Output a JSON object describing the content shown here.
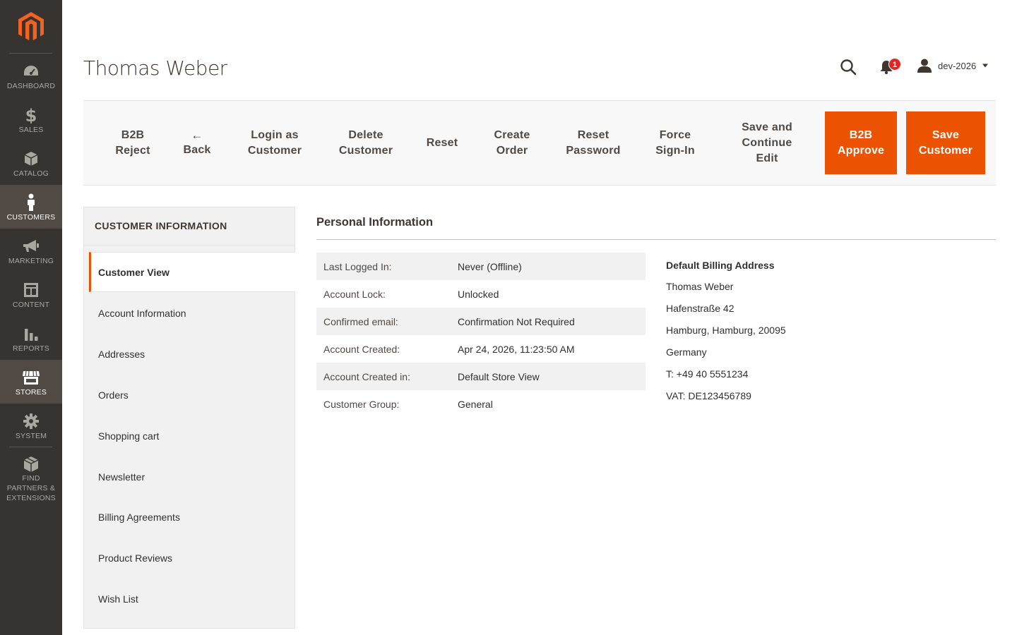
{
  "sidebar": {
    "logo": "magento-logo",
    "items": [
      {
        "label": "DASHBOARD",
        "icon": "dashboard-icon"
      },
      {
        "label": "SALES",
        "icon": "dollar-icon"
      },
      {
        "label": "CATALOG",
        "icon": "box-icon"
      },
      {
        "label": "CUSTOMERS",
        "icon": "person-icon",
        "active": true
      },
      {
        "label": "MARKETING",
        "icon": "megaphone-icon"
      },
      {
        "label": "CONTENT",
        "icon": "layout-icon"
      },
      {
        "label": "REPORTS",
        "icon": "bar-chart-icon"
      },
      {
        "label": "STORES",
        "icon": "storefront-icon",
        "highlight": true
      },
      {
        "label": "SYSTEM",
        "icon": "gear-icon"
      },
      {
        "label": "FIND PARTNERS & EXTENSIONS",
        "icon": "cube-icon"
      }
    ]
  },
  "header": {
    "title": "Thomas Weber",
    "notifications_count": "1",
    "username": "dev-2026"
  },
  "actions": {
    "b2b_reject": "B2B Reject",
    "back": "Back",
    "back_arrow": "←",
    "login_as_customer": "Login as Customer",
    "delete_customer": "Delete Customer",
    "reset": "Reset",
    "create_order": "Create Order",
    "reset_password": "Reset Password",
    "force_signin": "Force Sign-In",
    "save_continue": "Save and Continue Edit",
    "b2b_approve": "B2B Approve",
    "save_customer": "Save Customer"
  },
  "tabs": {
    "title": "CUSTOMER INFORMATION",
    "items": [
      "Customer View",
      "Account Information",
      "Addresses",
      "Orders",
      "Shopping cart",
      "Newsletter",
      "Billing Agreements",
      "Product Reviews",
      "Wish List"
    ]
  },
  "personal_info": {
    "title": "Personal Information",
    "rows": [
      {
        "label": "Last Logged In:",
        "value": "Never (Offline)"
      },
      {
        "label": "Account Lock:",
        "value": "Unlocked"
      },
      {
        "label": "Confirmed email:",
        "value": "Confirmation Not Required"
      },
      {
        "label": "Account Created:",
        "value": "Apr 24, 2026, 11:23:50 AM"
      },
      {
        "label": "Account Created in:",
        "value": "Default Store View"
      },
      {
        "label": "Customer Group:",
        "value": "General"
      }
    ]
  },
  "billing_address": {
    "title": "Default Billing Address",
    "lines": [
      "Thomas Weber",
      "Hafenstraße 42",
      "Hamburg, Hamburg, 20095",
      "Germany",
      "T: +49 40 5551234",
      "VAT: DE123456789"
    ]
  },
  "colors": {
    "sidebar_bg": "#373330",
    "accent": "#eb5202",
    "active_nav": "#514943"
  }
}
